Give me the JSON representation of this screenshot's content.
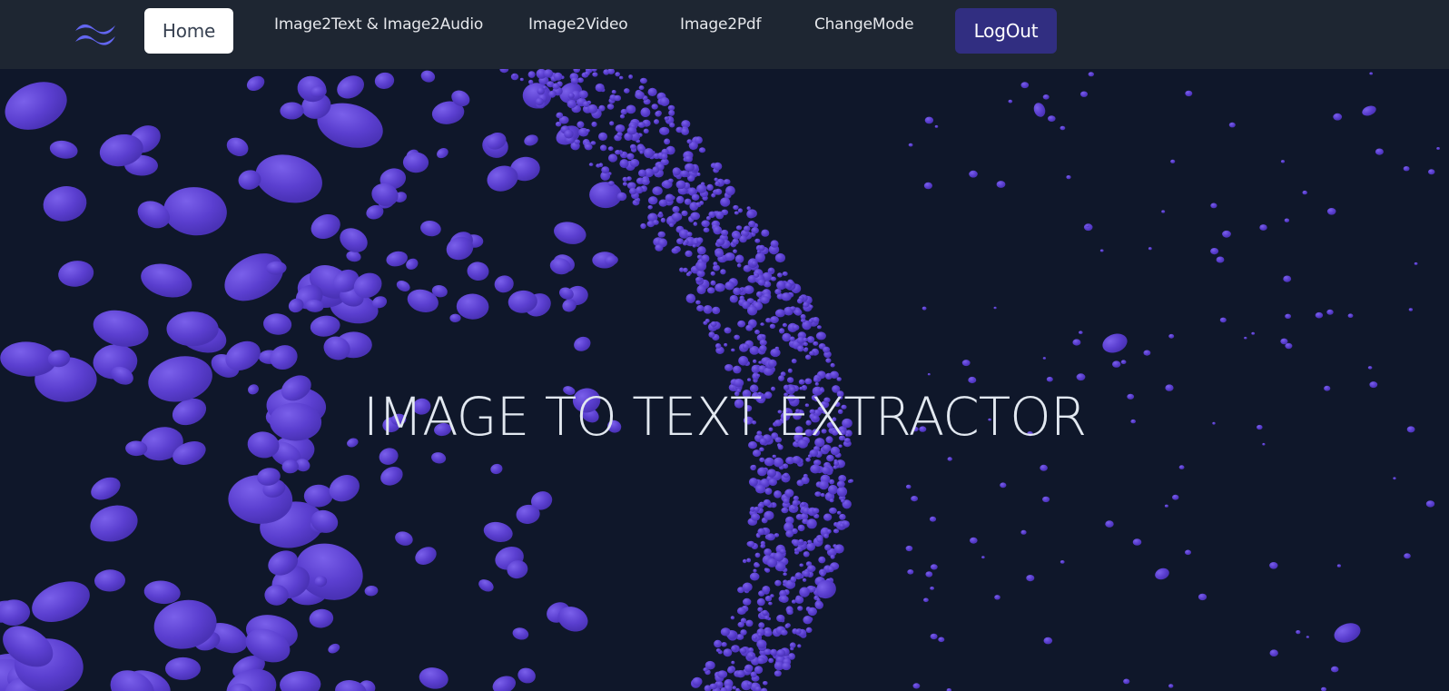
{
  "nav": {
    "home_label": "Home",
    "image2text_label": "Image2Text & Image2Audio",
    "image2video_label": "Image2Video",
    "image2pdf_label": "Image2Pdf",
    "changemode_label": "ChangeMode",
    "logout_label": "LogOut"
  },
  "hero": {
    "title": "IMAGE TO TEXT EXTRACTOR"
  },
  "colors": {
    "background": "#0f172a",
    "navbar": "#1e2632",
    "particle": "#5b3fd0",
    "accent": "#312e81",
    "logo": "#6366f1"
  },
  "icons": {
    "logo": "tailwind-wave-icon"
  }
}
